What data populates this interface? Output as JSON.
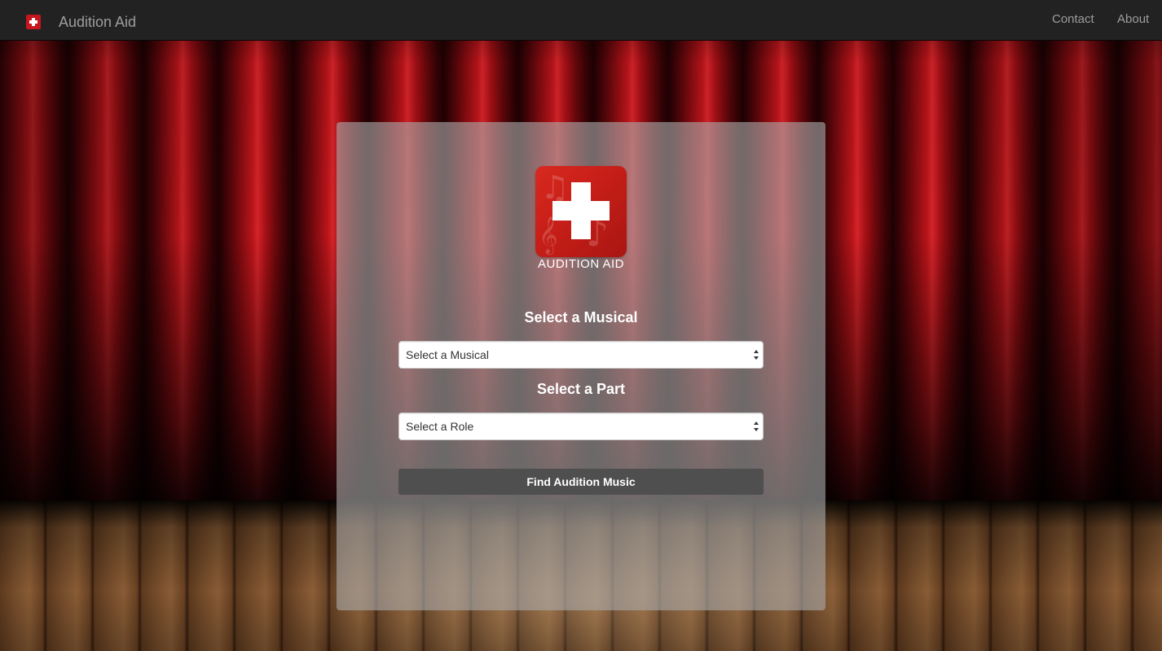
{
  "navbar": {
    "brand": "Audition Aid",
    "links": [
      {
        "label": "Contact"
      },
      {
        "label": "About"
      }
    ]
  },
  "panel": {
    "logo_caption": "AUDITION AID",
    "musical_heading": "Select a Musical",
    "musical_select": {
      "selected": "Select a Musical"
    },
    "part_heading": "Select a Part",
    "role_select": {
      "selected": "Select a Role"
    },
    "find_button_label": "Find Audition Music"
  },
  "colors": {
    "navbar_bg": "#222222",
    "nav_text": "#9d9d9d",
    "brand_red": "#c7161d",
    "button_bg": "#4f4f4f"
  },
  "icons": {
    "nav_logo": "audition-aid-logo-icon",
    "panel_logo": "audition-aid-logo-icon",
    "select_arrows": "updown-arrows-icon"
  }
}
